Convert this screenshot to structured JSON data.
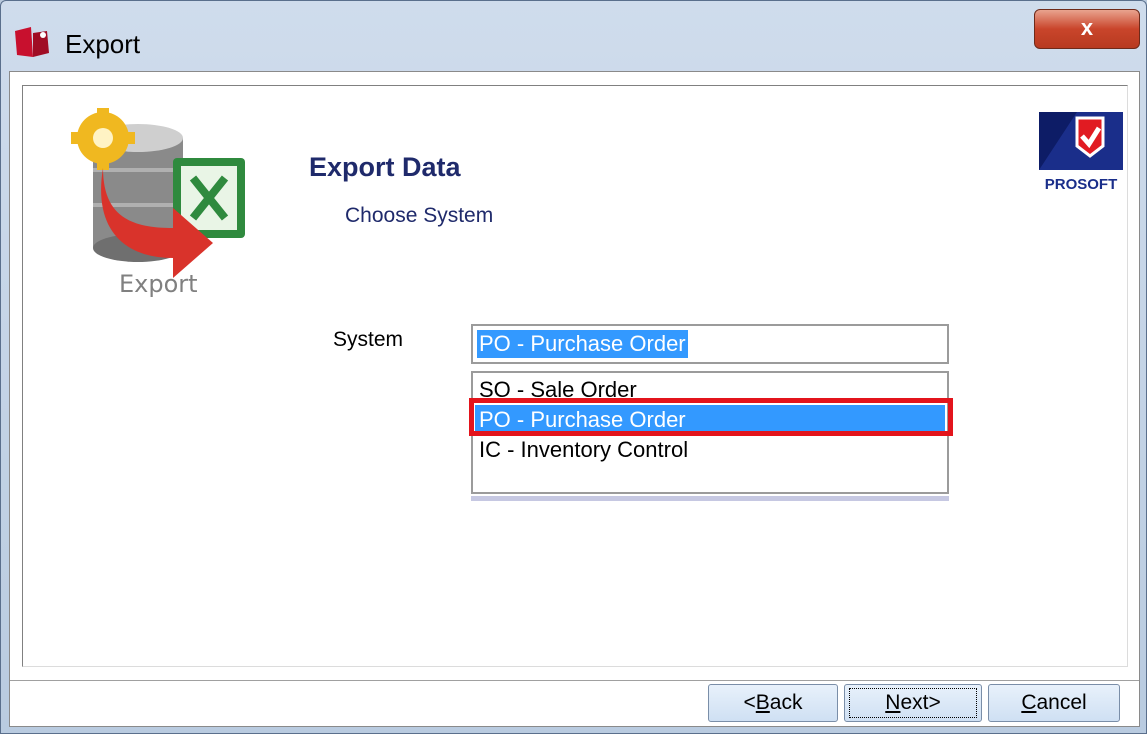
{
  "window": {
    "title": "Export",
    "close_label": "x"
  },
  "header": {
    "logo_caption": "Export",
    "heading": "Export Data",
    "subheading": "Choose System",
    "brand": "PROSOFT"
  },
  "form": {
    "system_label": "System",
    "selected_value": "PO - Purchase Order",
    "options": [
      "SO - Sale Order",
      "PO - Purchase Order",
      "IC - Inventory Control"
    ]
  },
  "buttons": {
    "back_prefix": "<",
    "back_key": "B",
    "back_rest": "ack",
    "next_key": "N",
    "next_rest": "ext>",
    "cancel_key": "C",
    "cancel_rest": "ancel"
  },
  "colors": {
    "selection": "#3399ff",
    "highlight_frame": "#e3141c",
    "heading": "#1f2a6b"
  }
}
